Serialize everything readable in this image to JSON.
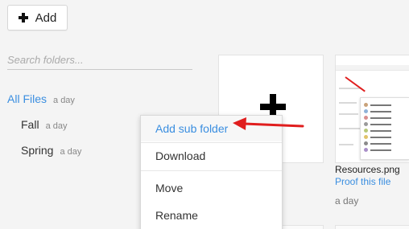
{
  "toolbar": {
    "add_label": "Add",
    "add_icon": "plus-icon"
  },
  "search": {
    "placeholder": "Search folders...",
    "value": ""
  },
  "folders": [
    {
      "name": "All Files",
      "age": "a day",
      "active": true
    },
    {
      "name": "Fall",
      "age": "a day",
      "active": false
    },
    {
      "name": "Spring",
      "age": "a day",
      "active": false
    }
  ],
  "new_tile": {
    "icon": "plus-icon"
  },
  "file": {
    "name": "Resources.png",
    "action": "Proof this file",
    "age": "a day"
  },
  "context_menu": {
    "items": [
      {
        "label": "Add sub folder",
        "highlighted": true
      },
      {
        "label": "Download",
        "highlighted": false
      },
      {
        "label": "Move",
        "highlighted": false
      },
      {
        "label": "Rename",
        "highlighted": false
      }
    ]
  },
  "colors": {
    "accent": "#3a8ee0",
    "annotation": "#e01e1e",
    "background": "#f4f4f4"
  }
}
